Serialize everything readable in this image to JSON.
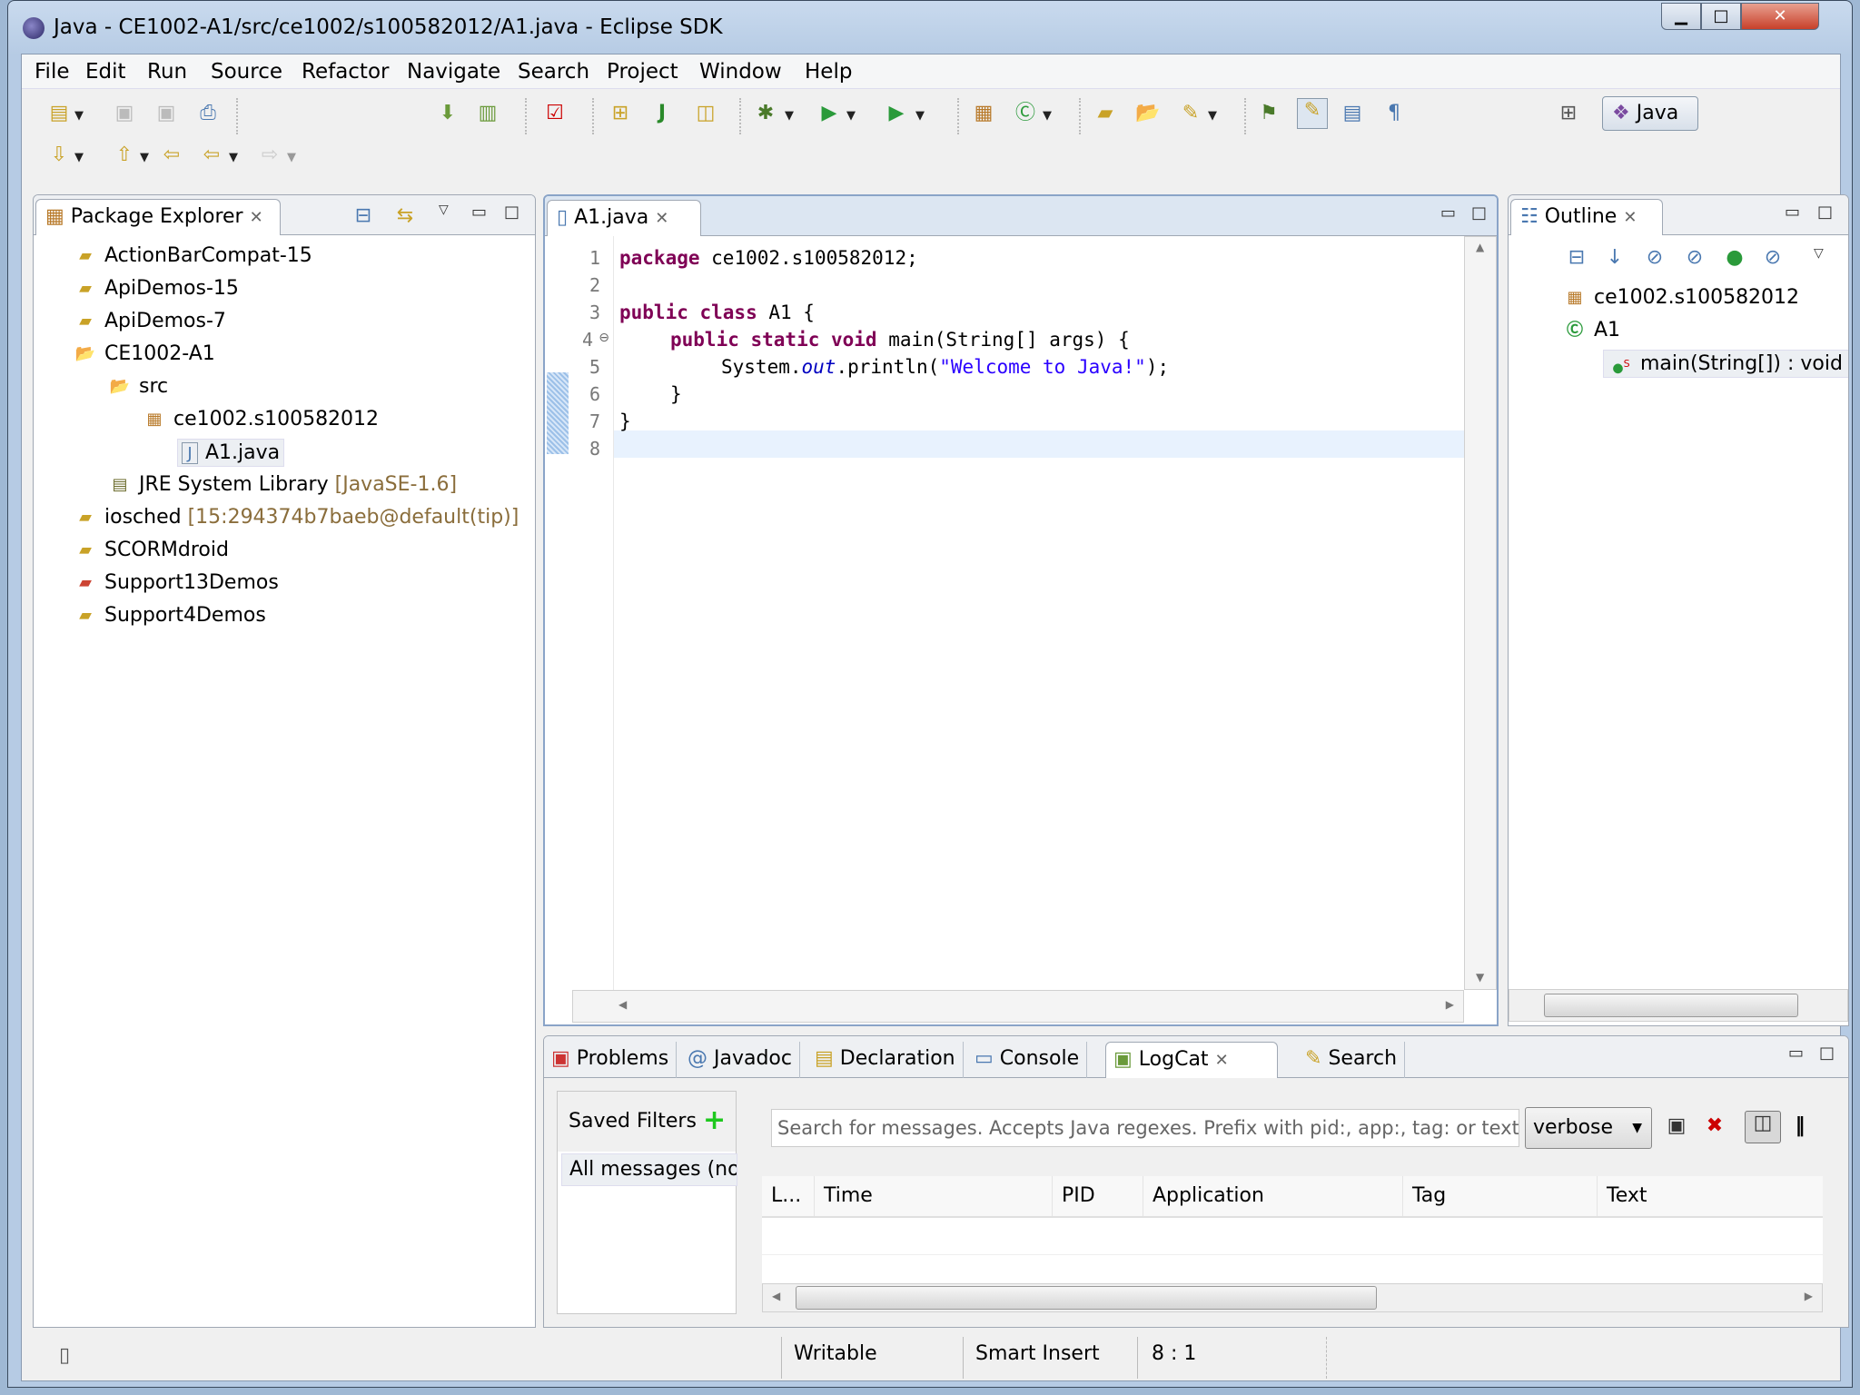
{
  "window": {
    "title": "Java - CE1002-A1/src/ce1002/s100582012/A1.java - Eclipse SDK",
    "minimize": "▁",
    "maximize": "□",
    "close": "✕"
  },
  "menu": [
    "File",
    "Edit",
    "Run",
    "Source",
    "Refactor",
    "Navigate",
    "Search",
    "Project",
    "Window",
    "Help"
  ],
  "perspective": {
    "label": "Java"
  },
  "package_explorer": {
    "title": "Package Explorer",
    "items": [
      {
        "label": "ActionBarCompat-15",
        "decoration": ""
      },
      {
        "label": "ApiDemos-15",
        "decoration": ""
      },
      {
        "label": "ApiDemos-7",
        "decoration": ""
      },
      {
        "label": "CE1002-A1",
        "decoration": ""
      },
      {
        "label": "src",
        "decoration": ""
      },
      {
        "label": "ce1002.s100582012",
        "decoration": ""
      },
      {
        "label": "A1.java",
        "decoration": ""
      },
      {
        "label": "JRE System Library",
        "decoration": "[JavaSE-1.6]"
      },
      {
        "label": "iosched",
        "decoration": "[15:294374b7baeb@default(tip)]"
      },
      {
        "label": "SCORMdroid",
        "decoration": ""
      },
      {
        "label": "Support13Demos",
        "decoration": ""
      },
      {
        "label": "Support4Demos",
        "decoration": ""
      }
    ]
  },
  "editor": {
    "tab": "A1.java",
    "line_numbers": [
      "1",
      "2",
      "3",
      "4",
      "5",
      "6",
      "7",
      "8"
    ],
    "code": {
      "l1_kw": "package",
      "l1_rest": " ce1002.s100582012;",
      "l3_kw": "public class",
      "l3_rest": " A1 {",
      "l4_kw": "public static void",
      "l4_rest": " main(String[] args) {",
      "l5_a": "System.",
      "l5_field": "out",
      "l5_b": ".println(",
      "l5_str": "\"Welcome to Java!\"",
      "l5_c": ");",
      "l6": "}",
      "l7": "}"
    }
  },
  "outline": {
    "title": "Outline",
    "items": [
      "ce1002.s100582012",
      "A1",
      "main(String[]) : void"
    ]
  },
  "bottom": {
    "tabs": [
      "Problems",
      "Javadoc",
      "Declaration",
      "Console",
      "LogCat",
      "Search"
    ],
    "active": "LogCat",
    "saved_filters": "Saved Filters",
    "filter_item": "All messages (no",
    "search_placeholder": "Search for messages. Accepts Java regexes. Prefix with pid:, app:, tag: or text",
    "level": "verbose",
    "columns": [
      "L...",
      "Time",
      "PID",
      "Application",
      "Tag",
      "Text"
    ]
  },
  "status": {
    "mode": "Writable",
    "insert": "Smart Insert",
    "position": "8 : 1"
  }
}
